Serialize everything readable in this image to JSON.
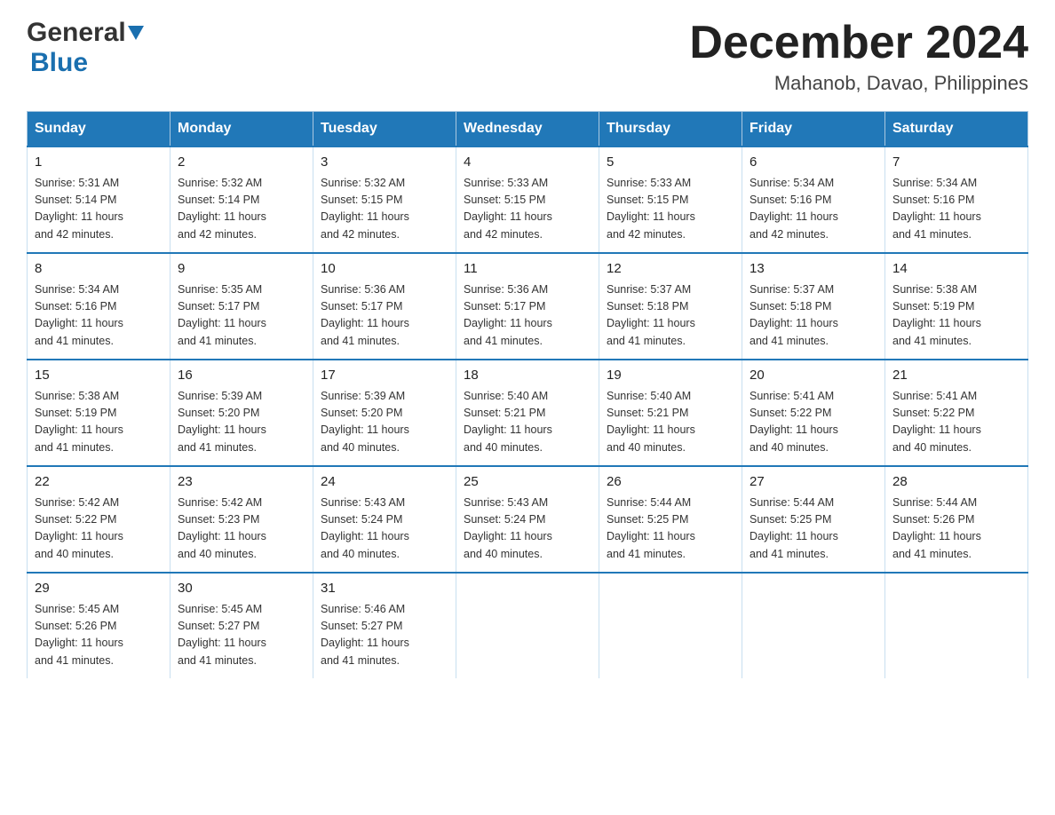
{
  "header": {
    "logo": {
      "general": "General",
      "blue": "Blue"
    },
    "title": "December 2024",
    "location": "Mahanob, Davao, Philippines"
  },
  "days_of_week": [
    "Sunday",
    "Monday",
    "Tuesday",
    "Wednesday",
    "Thursday",
    "Friday",
    "Saturday"
  ],
  "weeks": [
    [
      {
        "day": "1",
        "sunrise": "5:31 AM",
        "sunset": "5:14 PM",
        "daylight": "11 hours and 42 minutes."
      },
      {
        "day": "2",
        "sunrise": "5:32 AM",
        "sunset": "5:14 PM",
        "daylight": "11 hours and 42 minutes."
      },
      {
        "day": "3",
        "sunrise": "5:32 AM",
        "sunset": "5:15 PM",
        "daylight": "11 hours and 42 minutes."
      },
      {
        "day": "4",
        "sunrise": "5:33 AM",
        "sunset": "5:15 PM",
        "daylight": "11 hours and 42 minutes."
      },
      {
        "day": "5",
        "sunrise": "5:33 AM",
        "sunset": "5:15 PM",
        "daylight": "11 hours and 42 minutes."
      },
      {
        "day": "6",
        "sunrise": "5:34 AM",
        "sunset": "5:16 PM",
        "daylight": "11 hours and 42 minutes."
      },
      {
        "day": "7",
        "sunrise": "5:34 AM",
        "sunset": "5:16 PM",
        "daylight": "11 hours and 41 minutes."
      }
    ],
    [
      {
        "day": "8",
        "sunrise": "5:34 AM",
        "sunset": "5:16 PM",
        "daylight": "11 hours and 41 minutes."
      },
      {
        "day": "9",
        "sunrise": "5:35 AM",
        "sunset": "5:17 PM",
        "daylight": "11 hours and 41 minutes."
      },
      {
        "day": "10",
        "sunrise": "5:36 AM",
        "sunset": "5:17 PM",
        "daylight": "11 hours and 41 minutes."
      },
      {
        "day": "11",
        "sunrise": "5:36 AM",
        "sunset": "5:17 PM",
        "daylight": "11 hours and 41 minutes."
      },
      {
        "day": "12",
        "sunrise": "5:37 AM",
        "sunset": "5:18 PM",
        "daylight": "11 hours and 41 minutes."
      },
      {
        "day": "13",
        "sunrise": "5:37 AM",
        "sunset": "5:18 PM",
        "daylight": "11 hours and 41 minutes."
      },
      {
        "day": "14",
        "sunrise": "5:38 AM",
        "sunset": "5:19 PM",
        "daylight": "11 hours and 41 minutes."
      }
    ],
    [
      {
        "day": "15",
        "sunrise": "5:38 AM",
        "sunset": "5:19 PM",
        "daylight": "11 hours and 41 minutes."
      },
      {
        "day": "16",
        "sunrise": "5:39 AM",
        "sunset": "5:20 PM",
        "daylight": "11 hours and 41 minutes."
      },
      {
        "day": "17",
        "sunrise": "5:39 AM",
        "sunset": "5:20 PM",
        "daylight": "11 hours and 40 minutes."
      },
      {
        "day": "18",
        "sunrise": "5:40 AM",
        "sunset": "5:21 PM",
        "daylight": "11 hours and 40 minutes."
      },
      {
        "day": "19",
        "sunrise": "5:40 AM",
        "sunset": "5:21 PM",
        "daylight": "11 hours and 40 minutes."
      },
      {
        "day": "20",
        "sunrise": "5:41 AM",
        "sunset": "5:22 PM",
        "daylight": "11 hours and 40 minutes."
      },
      {
        "day": "21",
        "sunrise": "5:41 AM",
        "sunset": "5:22 PM",
        "daylight": "11 hours and 40 minutes."
      }
    ],
    [
      {
        "day": "22",
        "sunrise": "5:42 AM",
        "sunset": "5:22 PM",
        "daylight": "11 hours and 40 minutes."
      },
      {
        "day": "23",
        "sunrise": "5:42 AM",
        "sunset": "5:23 PM",
        "daylight": "11 hours and 40 minutes."
      },
      {
        "day": "24",
        "sunrise": "5:43 AM",
        "sunset": "5:24 PM",
        "daylight": "11 hours and 40 minutes."
      },
      {
        "day": "25",
        "sunrise": "5:43 AM",
        "sunset": "5:24 PM",
        "daylight": "11 hours and 40 minutes."
      },
      {
        "day": "26",
        "sunrise": "5:44 AM",
        "sunset": "5:25 PM",
        "daylight": "11 hours and 41 minutes."
      },
      {
        "day": "27",
        "sunrise": "5:44 AM",
        "sunset": "5:25 PM",
        "daylight": "11 hours and 41 minutes."
      },
      {
        "day": "28",
        "sunrise": "5:44 AM",
        "sunset": "5:26 PM",
        "daylight": "11 hours and 41 minutes."
      }
    ],
    [
      {
        "day": "29",
        "sunrise": "5:45 AM",
        "sunset": "5:26 PM",
        "daylight": "11 hours and 41 minutes."
      },
      {
        "day": "30",
        "sunrise": "5:45 AM",
        "sunset": "5:27 PM",
        "daylight": "11 hours and 41 minutes."
      },
      {
        "day": "31",
        "sunrise": "5:46 AM",
        "sunset": "5:27 PM",
        "daylight": "11 hours and 41 minutes."
      },
      null,
      null,
      null,
      null
    ]
  ],
  "labels": {
    "sunrise": "Sunrise:",
    "sunset": "Sunset:",
    "daylight": "Daylight:"
  }
}
